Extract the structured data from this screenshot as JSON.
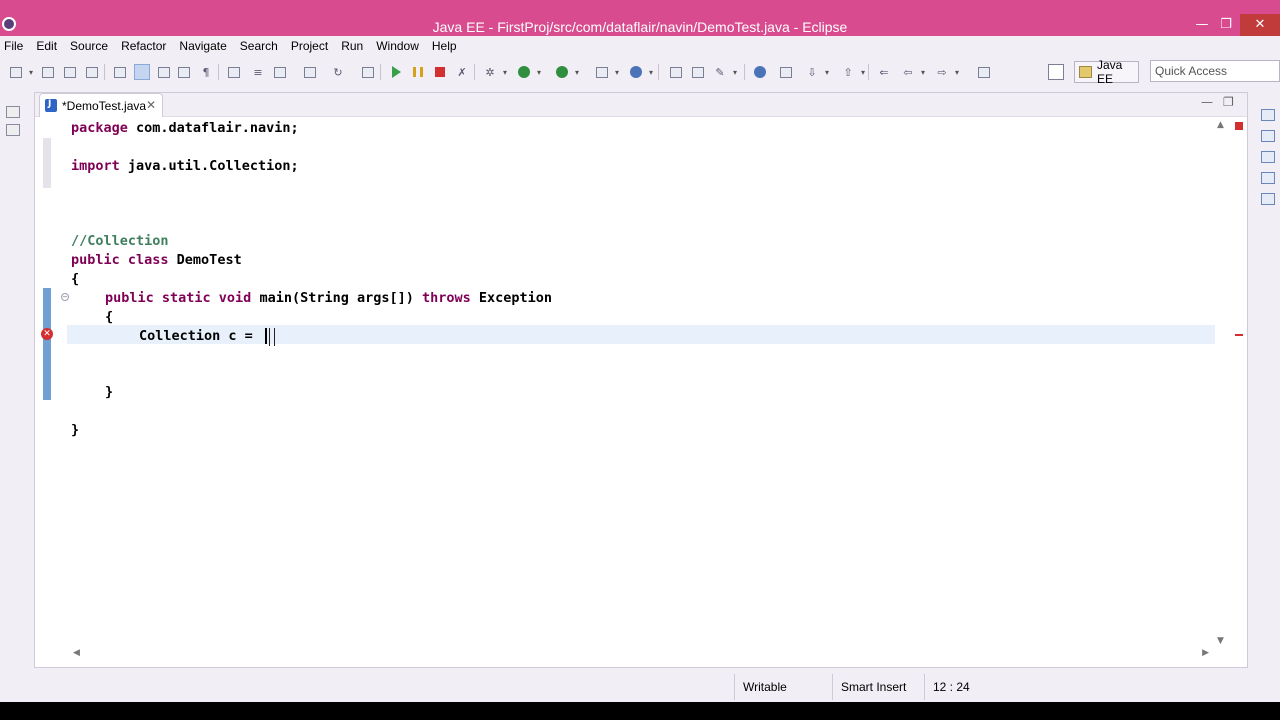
{
  "window": {
    "title": "Java EE - FirstProj/src/com/dataflair/navin/DemoTest.java - Eclipse",
    "controls": {
      "minimize": "—",
      "maximize": "❐",
      "close": "✕"
    }
  },
  "menu": [
    "File",
    "Edit",
    "Source",
    "Refactor",
    "Navigate",
    "Search",
    "Project",
    "Run",
    "Window",
    "Help"
  ],
  "toolbar": {
    "perspective_label": "Java EE",
    "quick_access_placeholder": "Quick Access"
  },
  "editor": {
    "tab_label": "*DemoTest.java",
    "tab_close": "✕",
    "panel_min": "—",
    "panel_max": "❐"
  },
  "code": {
    "line1_kw": "package",
    "line1_rest": " com.dataflair.navin;",
    "line2_kw": "import",
    "line2_rest": " java.util.Collection;",
    "line3_comment": "//Collection",
    "line4_kw": "public class",
    "line4_rest": " DemoTest",
    "line5": "{",
    "line6_kw": "public static void",
    "line6_mid": " main(String args[]) ",
    "line6_kw2": "throws",
    "line6_rest": " Exception",
    "line7": "{",
    "line8": "Collection c = ",
    "line9": "}",
    "line10": "}"
  },
  "status": {
    "writable": "Writable",
    "insert_mode": "Smart Insert",
    "position": "12 : 24"
  },
  "colors": {
    "titlebar": "#d84b8f",
    "keyword": "#7f0055",
    "comment": "#3f7f5f",
    "error": "#d23030",
    "change_bar": "#6f9fd3"
  }
}
